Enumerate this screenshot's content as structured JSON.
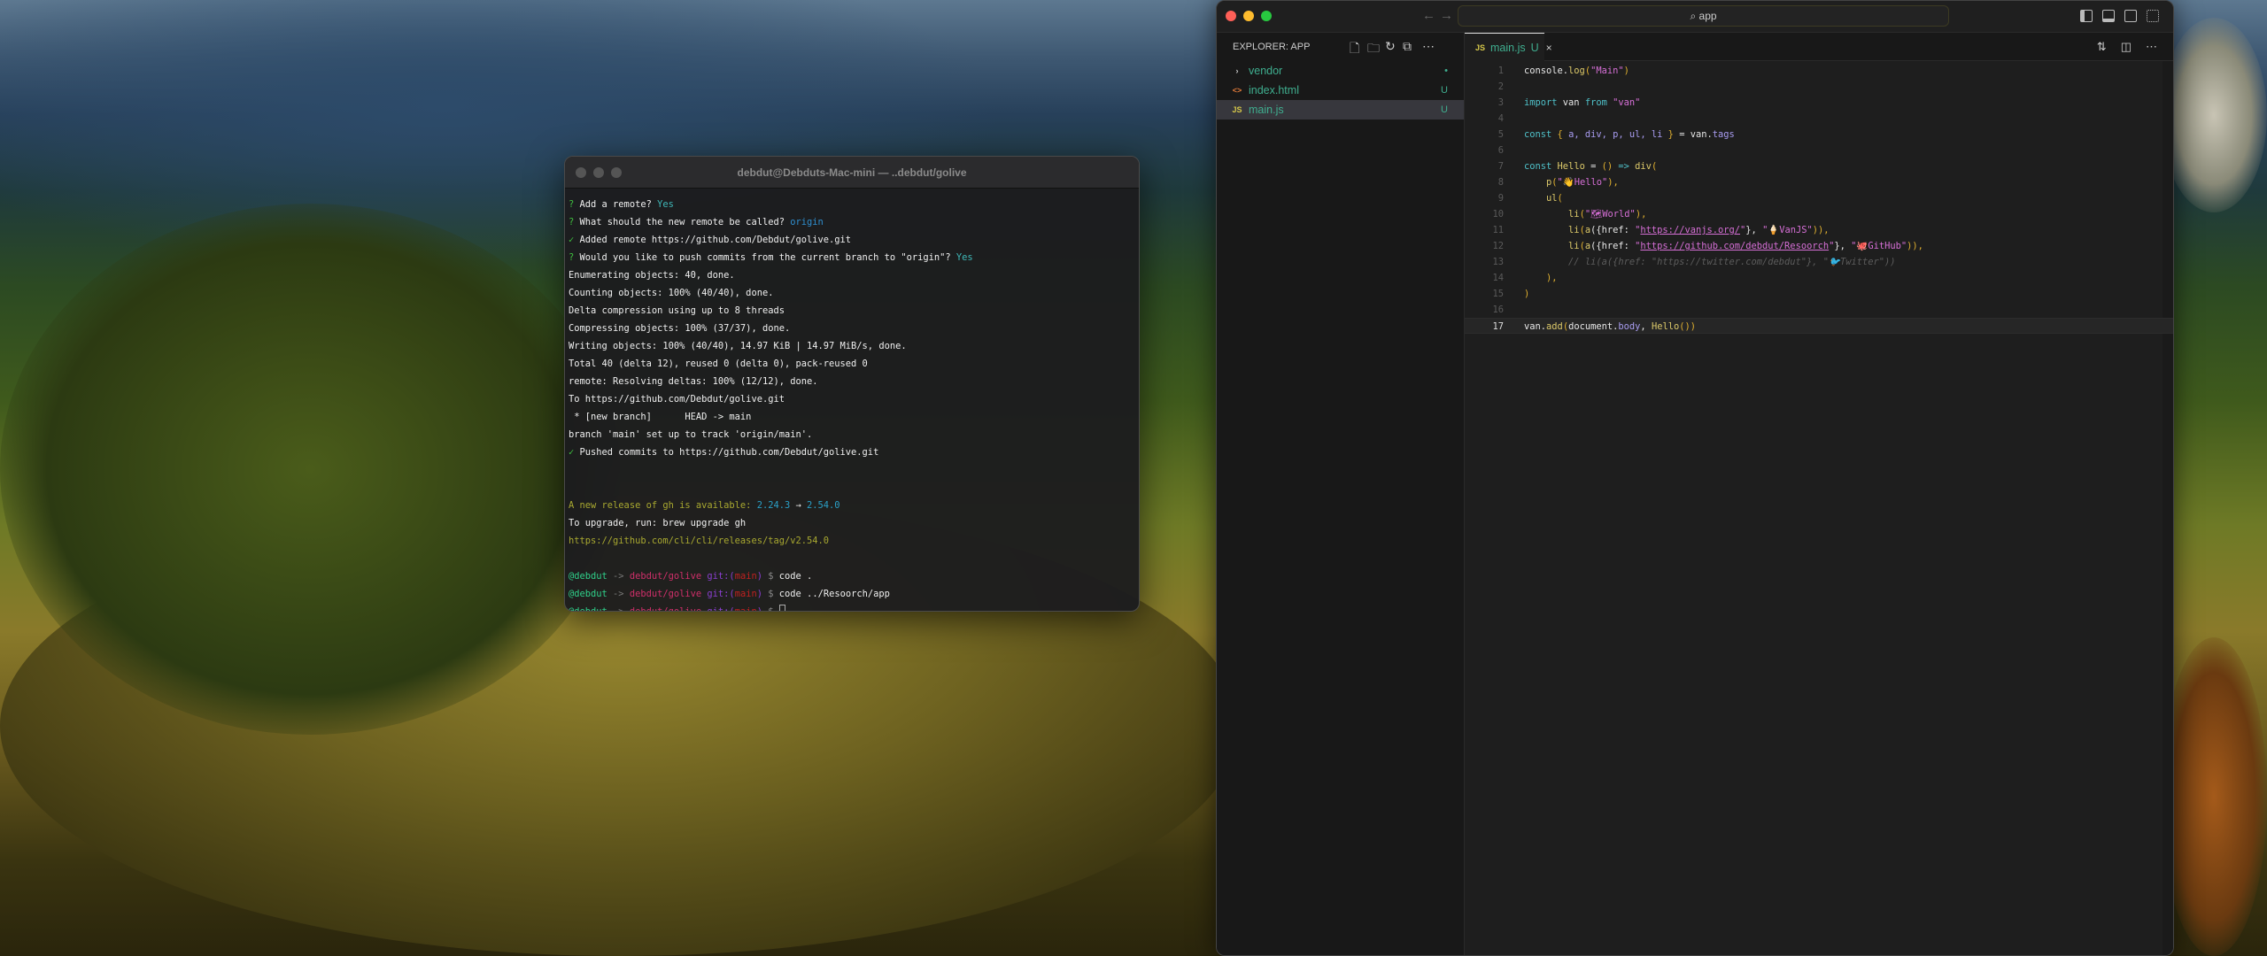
{
  "terminal": {
    "title": "debdut@Debduts-Mac-mini — ..debdut/golive",
    "lines": [
      [
        [
          "? ",
          "c-q"
        ],
        [
          "Add a remote? ",
          "c-w"
        ],
        [
          "Yes",
          "c-ans"
        ]
      ],
      [
        [
          "? ",
          "c-q"
        ],
        [
          "What should the new remote be called? ",
          "c-w"
        ],
        [
          "origin",
          "c-blue"
        ]
      ],
      [
        [
          "✓ ",
          "c-ok"
        ],
        [
          "Added remote https://github.com/Debdut/golive.git",
          "c-w"
        ]
      ],
      [
        [
          "? ",
          "c-q"
        ],
        [
          "Would you like to push commits from the current branch to \"origin\"? ",
          "c-w"
        ],
        [
          "Yes",
          "c-ans"
        ]
      ],
      [
        [
          "Enumerating objects: 40, done.",
          "c-w"
        ]
      ],
      [
        [
          "Counting objects: 100% (40/40), done.",
          "c-w"
        ]
      ],
      [
        [
          "Delta compression using up to 8 threads",
          "c-w"
        ]
      ],
      [
        [
          "Compressing objects: 100% (37/37), done.",
          "c-w"
        ]
      ],
      [
        [
          "Writing objects: 100% (40/40), 14.97 KiB | 14.97 MiB/s, done.",
          "c-w"
        ]
      ],
      [
        [
          "Total 40 (delta 12), reused 0 (delta 0), pack-reused 0",
          "c-w"
        ]
      ],
      [
        [
          "remote: Resolving deltas: 100% (12/12), done.",
          "c-w"
        ]
      ],
      [
        [
          "To https://github.com/Debdut/golive.git",
          "c-w"
        ]
      ],
      [
        [
          " * [new branch]      HEAD -> main",
          "c-w"
        ]
      ],
      [
        [
          "branch 'main' set up to track 'origin/main'.",
          "c-w"
        ]
      ],
      [
        [
          "✓ ",
          "c-ok"
        ],
        [
          "Pushed commits to https://github.com/Debdut/golive.git",
          "c-w"
        ]
      ],
      [],
      [],
      [
        [
          "A new release of gh is available: ",
          "c-yel"
        ],
        [
          "2.24.3",
          "c-ver"
        ],
        [
          " → ",
          "c-w"
        ],
        [
          "2.54.0",
          "c-ver"
        ]
      ],
      [
        [
          "To upgrade, run: brew upgrade gh",
          "c-w"
        ]
      ],
      [
        [
          "https://github.com/cli/cli/releases/tag/v2.54.0",
          "c-yel"
        ]
      ],
      [],
      [
        [
          "@debdut",
          "c-user"
        ],
        [
          " -> ",
          "c-arrow"
        ],
        [
          "debdut/golive",
          "c-path"
        ],
        [
          " git:(",
          "c-git"
        ],
        [
          "main",
          "c-br"
        ],
        [
          ")",
          "c-git"
        ],
        [
          " $ ",
          "c-dollar"
        ],
        [
          "code .",
          "c-w"
        ]
      ],
      [
        [
          "@debdut",
          "c-user"
        ],
        [
          " -> ",
          "c-arrow"
        ],
        [
          "debdut/golive",
          "c-path"
        ],
        [
          " git:(",
          "c-git"
        ],
        [
          "main",
          "c-br"
        ],
        [
          ")",
          "c-git"
        ],
        [
          " $ ",
          "c-dollar"
        ],
        [
          "code ../Resoorch/app",
          "c-w"
        ]
      ],
      [
        [
          "@debdut",
          "c-user"
        ],
        [
          " -> ",
          "c-arrow"
        ],
        [
          "debdut/golive",
          "c-path"
        ],
        [
          " git:(",
          "c-git"
        ],
        [
          "main",
          "c-br"
        ],
        [
          ")",
          "c-git"
        ],
        [
          " $ ",
          "c-dollar"
        ]
      ]
    ]
  },
  "vscode": {
    "search": "app",
    "explorer_title": "EXPLORER: APP",
    "files": [
      {
        "name": "vendor",
        "icon": "›",
        "status": "•",
        "selected": false
      },
      {
        "name": "index.html",
        "icon": "<>",
        "status": "U",
        "selected": false
      },
      {
        "name": "main.js",
        "icon": "JS",
        "status": "U",
        "selected": true
      }
    ],
    "tab": {
      "icon": "JS",
      "name": "main.js",
      "status": "U",
      "close": "×"
    },
    "current_line": 17,
    "code": [
      [
        [
          "console.",
          "t-id"
        ],
        [
          "log",
          "t-fn"
        ],
        [
          "(",
          "t-p"
        ],
        [
          "\"Main\"",
          "t-str"
        ],
        [
          ")",
          "t-p"
        ]
      ],
      [],
      [
        [
          "import ",
          "t-kw"
        ],
        [
          "van ",
          "t-id"
        ],
        [
          "from ",
          "t-kw"
        ],
        [
          "\"van\"",
          "t-str"
        ]
      ],
      [],
      [
        [
          "const ",
          "t-kw"
        ],
        [
          "{ ",
          "t-p"
        ],
        [
          "a, div, p, ul, li ",
          "t-prop"
        ],
        [
          "} ",
          "t-p"
        ],
        [
          "= van.",
          "t-id"
        ],
        [
          "tags",
          "t-prop"
        ]
      ],
      [],
      [
        [
          "const ",
          "t-kw"
        ],
        [
          "Hello ",
          "t-fn"
        ],
        [
          "= ",
          "t-op"
        ],
        [
          "() ",
          "t-p"
        ],
        [
          "=> ",
          "t-kw"
        ],
        [
          "div",
          "t-fn"
        ],
        [
          "(",
          "t-p"
        ]
      ],
      [
        [
          "    p",
          "t-fn"
        ],
        [
          "(",
          "t-p"
        ],
        [
          "\"👋Hello\"",
          "t-str"
        ],
        [
          "),",
          "t-p"
        ]
      ],
      [
        [
          "    ul",
          "t-fn"
        ],
        [
          "(",
          "t-p"
        ]
      ],
      [
        [
          "        li",
          "t-fn"
        ],
        [
          "(",
          "t-p"
        ],
        [
          "\"🗺World\"",
          "t-str"
        ],
        [
          "),",
          "t-p"
        ]
      ],
      [
        [
          "        li",
          "t-fn"
        ],
        [
          "(",
          "t-p"
        ],
        [
          "a",
          "t-fn"
        ],
        [
          "({href: ",
          "t-id"
        ],
        [
          "\"",
          "t-str"
        ],
        [
          "https://vanjs.org/",
          "t-url"
        ],
        [
          "\"",
          "t-str"
        ],
        [
          "}, ",
          "t-id"
        ],
        [
          "\"🍦VanJS\"",
          "t-str"
        ],
        [
          ")),",
          "t-p"
        ]
      ],
      [
        [
          "        li",
          "t-fn"
        ],
        [
          "(",
          "t-p"
        ],
        [
          "a",
          "t-fn"
        ],
        [
          "({href: ",
          "t-id"
        ],
        [
          "\"",
          "t-str"
        ],
        [
          "https://github.com/debdut/Resoorch",
          "t-url"
        ],
        [
          "\"",
          "t-str"
        ],
        [
          "}, ",
          "t-id"
        ],
        [
          "\"🐙GitHub\"",
          "t-str"
        ],
        [
          ")),",
          "t-p"
        ]
      ],
      [
        [
          "        // li(a({href: \"https://twitter.com/debdut\"}, \"🐦Twitter\"))",
          "t-com"
        ]
      ],
      [
        [
          "    ),",
          "t-p"
        ]
      ],
      [
        [
          ")",
          "t-p"
        ]
      ],
      [],
      [
        [
          "van.",
          "t-id"
        ],
        [
          "add",
          "t-fn"
        ],
        [
          "(",
          "t-p"
        ],
        [
          "document.",
          "t-id"
        ],
        [
          "body",
          "t-prop"
        ],
        [
          ", ",
          "t-id"
        ],
        [
          "Hello",
          "t-fn"
        ],
        [
          "()",
          "t-p"
        ],
        [
          ")",
          "t-p"
        ]
      ]
    ]
  }
}
